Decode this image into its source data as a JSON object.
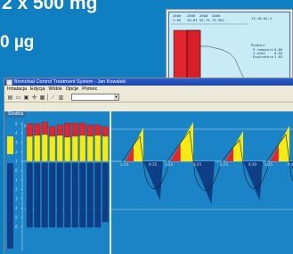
{
  "background": {
    "dose_line_1": "2 x 500 mg",
    "dose_line_2": "0 µg"
  },
  "inset": {
    "header_line_1": [
      "2000",
      "2000",
      "2000",
      "2000",
      "11:18:04.4"
    ],
    "header_line_2": [
      "2:05",
      "20:63",
      "93.75",
      "73.563"
    ],
    "labels": [
      "Punktur",
      "P-reagiert",
      "I-echo",
      "Expiratory"
    ],
    "values": [
      "0.05",
      "0.05",
      "1.02"
    ]
  },
  "window": {
    "title": "Bronchial Control Treatment System - Jan Kowalski",
    "menu": [
      "Inhalacja",
      "Edycja",
      "Widok",
      "Opcje",
      "Pomoc"
    ],
    "toolbar_icons": [
      "new-icon",
      "open-icon",
      "save-icon",
      "settings-icon",
      "print-icon",
      "chart-icon",
      "export-icon"
    ],
    "left_tab": "Średnia",
    "left_axis_label": "VC",
    "left_y_ticks": [
      "5",
      "4",
      "3",
      "2",
      "1",
      "0",
      "1",
      "2",
      "3",
      "4",
      "5",
      "6"
    ],
    "right_time_labels": [
      "0:14",
      "0:15",
      "0:20",
      "0:25",
      "0:25",
      "0:30",
      "0:35",
      "0:40"
    ]
  },
  "colors": {
    "background": "#0f7fc2",
    "panel": "#1b84c6",
    "red": "#e3262e",
    "yellow": "#f5ea14",
    "navy": "#0e3f86"
  }
}
